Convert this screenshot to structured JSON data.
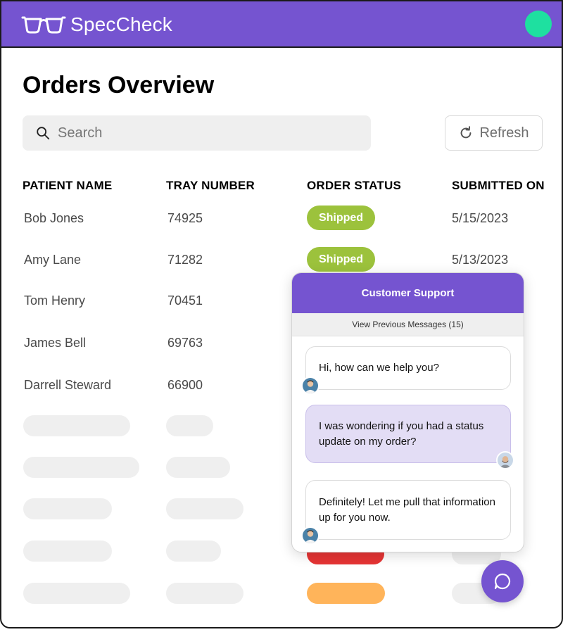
{
  "app": {
    "name": "SpecCheck",
    "icon": "glasses-icon"
  },
  "colors": {
    "brand": "#7554d0",
    "status_online": "#1ee0a0",
    "shipped": "#9cc23c",
    "error": "#e53434",
    "pending": "#ffb45a"
  },
  "page": {
    "title": "Orders Overview"
  },
  "search": {
    "placeholder": "Search",
    "icon": "search-icon"
  },
  "toolbar": {
    "refresh_label": "Refresh",
    "refresh_icon": "refresh-icon"
  },
  "table": {
    "columns": [
      "PATIENT NAME",
      "TRAY NUMBER",
      "ORDER STATUS",
      "SUBMITTED ON"
    ],
    "rows": [
      {
        "patient": "Bob Jones",
        "tray": "74925",
        "status": "Shipped",
        "submitted": "5/15/2023"
      },
      {
        "patient": "Amy Lane",
        "tray": "71282",
        "status": "Shipped",
        "submitted": "5/13/2023"
      },
      {
        "patient": "Tom Henry",
        "tray": "70451"
      },
      {
        "patient": "James Bell",
        "tray": "69763"
      },
      {
        "patient": "Darrell Steward",
        "tray": "66900"
      }
    ]
  },
  "chat": {
    "title": "Customer Support",
    "previous_label": "View Previous Messages (15)",
    "messages": [
      {
        "from": "agent",
        "text": "Hi, how can we help you?"
      },
      {
        "from": "user",
        "text": "I was wondering if you had a status update on my order?"
      },
      {
        "from": "agent",
        "text": "Definitely! Let me pull that information up for you now."
      }
    ],
    "fab_icon": "chat-bubble-icon"
  }
}
